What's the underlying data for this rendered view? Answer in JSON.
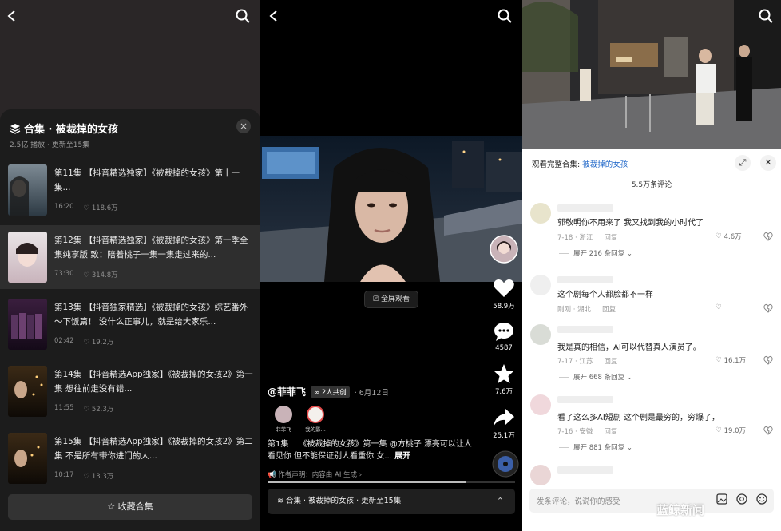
{
  "left": {
    "title": "合集 · 被裁掉的女孩",
    "subtitle": "2.5亿 播放 · 更新至15集",
    "close_icon": "×",
    "episodes": [
      {
        "title": "第11集 【抖音精选独家】《被裁掉的女孩》第十一集...",
        "duration": "16:20",
        "likes": "118.6万"
      },
      {
        "title": "第12集 【抖音精选独家】《被裁掉的女孩》第一季全集纯享版 致：陪着桃子一集一集走过来的...",
        "duration": "73:30",
        "likes": "314.8万"
      },
      {
        "title": "第13集 【抖音独家精选】《被裁掉的女孩》综艺番外～下饭篇！ 没什么正事儿，就是给大家乐...",
        "duration": "02:42",
        "likes": "19.2万"
      },
      {
        "title": "第14集 【抖音精选App独家】《被裁掉的女孩2》第一集 想往前走没有错...",
        "duration": "11:55",
        "likes": "52.3万"
      },
      {
        "title": "第15集 【抖音精选App独家】《被裁掉的女孩2》第二集 不是所有带你进门的人...",
        "duration": "10:17",
        "likes": "13.3万"
      }
    ],
    "collect_label": "☆ 收藏合集"
  },
  "middle": {
    "fullscreen_label": "全屏观看",
    "like_count": "58.9万",
    "comment_count": "4587",
    "fav_count": "7.6万",
    "share_count": "25.1万",
    "author": "@菲菲飞",
    "cocreate": "∞ 2人共创",
    "date": "· 6月12日",
    "coauthors": [
      "菲菲飞",
      "我的影..."
    ],
    "desc": "第1集 ｜《被裁掉的女孩》第一集 @方桃子 漂亮可以让人看见你 但不能保证别人看重你 女...",
    "desc_more": "展开",
    "ai_note": "作者声明：内容由 AI 生成 ›",
    "collection_bar": "合集 · 被裁掉的女孩 · 更新至15集",
    "progress": 0.8
  },
  "right": {
    "header_prefix": "观看完整合集: ",
    "header_link": "被裁掉的女孩",
    "count": "5.5万条评论",
    "comments": [
      {
        "text": "郭敬明你不用来了 我又找到我的小时代了",
        "time": "7-18 · 浙江",
        "reply": "回复",
        "likes": "4.6万",
        "expand": "展开 216 条回复 ⌄"
      },
      {
        "text": "这个剧每个人都脸都不一样",
        "time": "刚刚 · 湖北",
        "reply": "回复",
        "likes": "",
        "expand": ""
      },
      {
        "text": "我是真的相信，AI可以代替真人演员了。",
        "time": "7-17 · 江苏",
        "reply": "回复",
        "likes": "16.1万",
        "expand": "展开 668 条回复 ⌄"
      },
      {
        "text": "看了这么多AI短剧 这个剧是最穷的，穷爆了，",
        "time": "7-16 · 安徽",
        "reply": "回复",
        "likes": "19.0万",
        "expand": "展开 881 条回复 ⌄"
      }
    ],
    "input_placeholder": "发条评论，说说你的感受"
  },
  "watermark": "蓝鲸新闻"
}
